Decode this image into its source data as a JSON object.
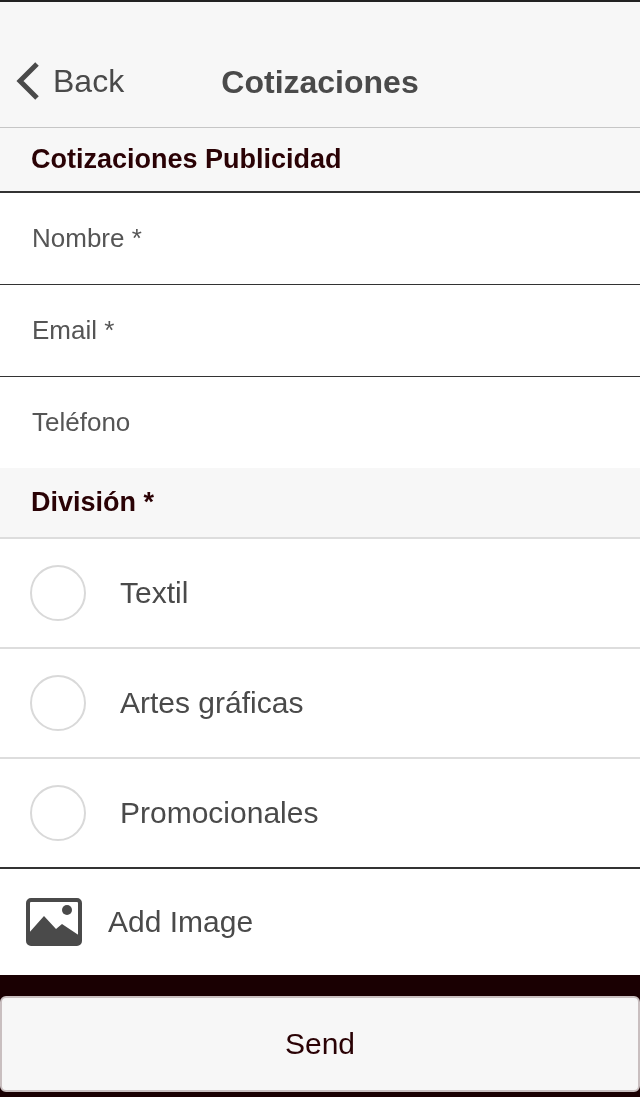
{
  "nav": {
    "back_label": "Back",
    "title": "Cotizaciones"
  },
  "form": {
    "title": "Cotizaciones Publicidad",
    "fields": [
      {
        "placeholder": "Nombre *"
      },
      {
        "placeholder": "Email *"
      },
      {
        "placeholder": "Teléfono"
      }
    ]
  },
  "division": {
    "label": "División *",
    "options": [
      {
        "label": "Textil",
        "selected": false
      },
      {
        "label": "Artes gráficas",
        "selected": false
      },
      {
        "label": "Promocionales",
        "selected": false
      }
    ]
  },
  "add_image": {
    "label": "Add Image"
  },
  "send_button": {
    "label": "Send"
  }
}
